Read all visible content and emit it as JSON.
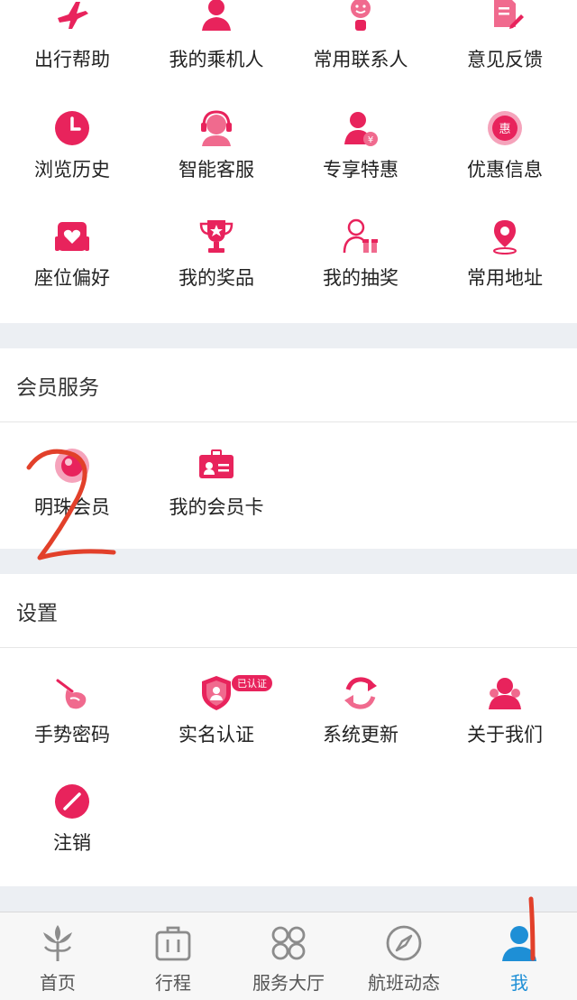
{
  "colors": {
    "accent": "#e8235c",
    "tab_active": "#1e8fd6",
    "tab_inactive": "#8c8c8c",
    "separator": "#eceff3"
  },
  "services": [
    {
      "label": "出行帮助",
      "icon": "airplane-icon"
    },
    {
      "label": "我的乘机人",
      "icon": "passenger-icon"
    },
    {
      "label": "常用联系人",
      "icon": "contact-icon"
    },
    {
      "label": "意见反馈",
      "icon": "feedback-icon"
    },
    {
      "label": "浏览历史",
      "icon": "clock-icon"
    },
    {
      "label": "智能客服",
      "icon": "headset-icon"
    },
    {
      "label": "专享特惠",
      "icon": "exclusive-offer-icon"
    },
    {
      "label": "优惠信息",
      "icon": "discount-badge-icon"
    },
    {
      "label": "座位偏好",
      "icon": "seat-icon"
    },
    {
      "label": "我的奖品",
      "icon": "trophy-icon"
    },
    {
      "label": "我的抽奖",
      "icon": "lottery-icon"
    },
    {
      "label": "常用地址",
      "icon": "location-pin-icon"
    }
  ],
  "member": {
    "title": "会员服务",
    "items": [
      {
        "label": "明珠会员",
        "icon": "pearl-member-icon"
      },
      {
        "label": "我的会员卡",
        "icon": "member-card-icon"
      }
    ]
  },
  "settings": {
    "title": "设置",
    "items": [
      {
        "label": "手势密码",
        "icon": "gesture-icon"
      },
      {
        "label": "实名认证",
        "icon": "verified-shield-icon",
        "badge": "已认证"
      },
      {
        "label": "系统更新",
        "icon": "refresh-icon"
      },
      {
        "label": "关于我们",
        "icon": "about-us-icon"
      },
      {
        "label": "注销",
        "icon": "logout-icon"
      }
    ]
  },
  "tabs": [
    {
      "label": "首页",
      "icon": "home-logo-icon",
      "active": false
    },
    {
      "label": "行程",
      "icon": "luggage-icon",
      "active": false
    },
    {
      "label": "服务大厅",
      "icon": "service-hall-icon",
      "active": false
    },
    {
      "label": "航班动态",
      "icon": "compass-icon",
      "active": false
    },
    {
      "label": "我",
      "icon": "profile-icon",
      "active": true
    }
  ]
}
